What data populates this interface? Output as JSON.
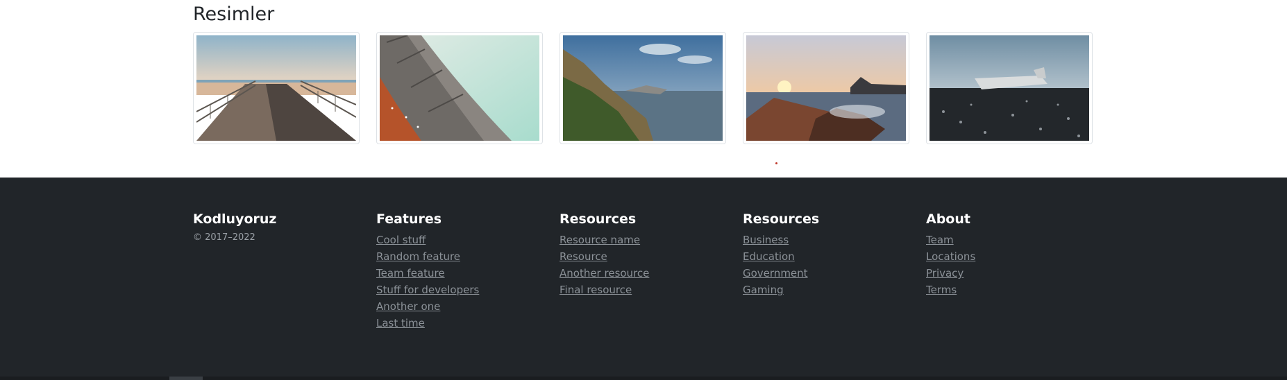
{
  "gallery": {
    "title": "Resimler",
    "images": [
      {
        "name": "boardwalk-pier-image",
        "icon": "pier"
      },
      {
        "name": "curved-building-image",
        "icon": "building"
      },
      {
        "name": "coastal-cliffs-image",
        "icon": "cliffs"
      },
      {
        "name": "sunset-rocks-image",
        "icon": "sunset"
      },
      {
        "name": "plane-wreck-image",
        "icon": "plane"
      }
    ]
  },
  "footer": {
    "brand": {
      "title": "Kodluyoruz",
      "copyright": "© 2017–2022"
    },
    "columns": [
      {
        "title": "Features",
        "links": [
          "Cool stuff",
          "Random feature",
          "Team feature",
          "Stuff for developers",
          "Another one",
          "Last time"
        ]
      },
      {
        "title": "Resources",
        "links": [
          "Resource name",
          "Resource",
          "Another resource",
          "Final resource"
        ]
      },
      {
        "title": "Resources",
        "links": [
          "Business",
          "Education",
          "Government",
          "Gaming"
        ]
      },
      {
        "title": "About",
        "links": [
          "Team",
          "Locations",
          "Privacy",
          "Terms"
        ]
      }
    ]
  },
  "colors": {
    "footer_bg": "#212529",
    "link": "#8b9197",
    "heading": "#ffffff"
  }
}
